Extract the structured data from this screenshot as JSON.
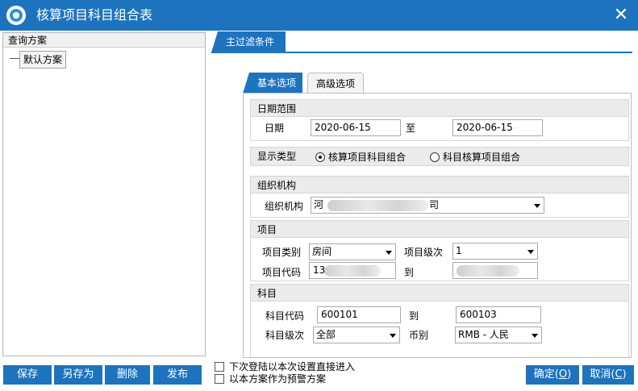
{
  "window": {
    "title": "核算项目科目组合表",
    "close_glyph": "✕"
  },
  "left": {
    "header": "查询方案",
    "tree_item": "默认方案"
  },
  "right": {
    "main_tab": "主过滤条件",
    "tabs": [
      {
        "label": "基本选项"
      },
      {
        "label": "高级选项"
      }
    ]
  },
  "date_range": {
    "section": "日期范围",
    "label": "日期",
    "from": "2020-06-15",
    "to_label": "至",
    "to": "2020-06-15"
  },
  "display_type": {
    "section": "显示类型",
    "options": [
      "核算项目科目组合",
      "科目核算项目组合"
    ],
    "selected": 0
  },
  "org": {
    "section": "组织机构",
    "label": "组织机构",
    "value_prefix": "河",
    "value_suffix": "司"
  },
  "item": {
    "section": "项目",
    "type_label": "项目类别",
    "type_value": "房间",
    "level_label": "项目级次",
    "level_value": "1",
    "code_label": "项目代码",
    "code_from_prefix": "13",
    "to_label": "到"
  },
  "subject": {
    "section": "科目",
    "code_label": "科目代码",
    "code_from": "600101",
    "to_label": "到",
    "code_to": "600103",
    "level_label": "科目级次",
    "level_value": "全部",
    "currency_label": "币别",
    "currency_value": "RMB - 人民"
  },
  "footer": {
    "buttons": [
      "保存",
      "另存为",
      "删除",
      "发布"
    ],
    "checks": [
      "下次登陆以本次设置直接进入",
      "以本方案作为预警方案"
    ],
    "ok_text": "确定(",
    "ok_key": "O",
    "ok_end": ")",
    "cancel_text": "取消(",
    "cancel_key": "C",
    "cancel_end": ")"
  }
}
